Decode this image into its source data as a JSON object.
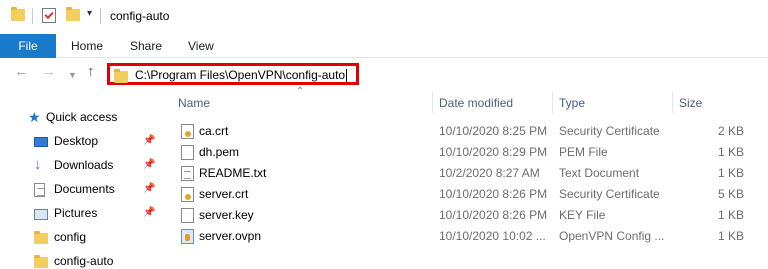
{
  "window": {
    "title": "config-auto"
  },
  "ribbon": {
    "tabs": [
      "File",
      "Home",
      "Share",
      "View"
    ]
  },
  "navigation": {
    "address": "C:\\Program Files\\OpenVPN\\config-auto"
  },
  "columns": {
    "name": "Name",
    "date": "Date modified",
    "type": "Type",
    "size": "Size"
  },
  "sidebar": {
    "items": [
      {
        "label": "Quick access",
        "icon": "star-icon",
        "pinned": false
      },
      {
        "label": "Desktop",
        "icon": "desktop-icon",
        "pinned": true
      },
      {
        "label": "Downloads",
        "icon": "download-icon",
        "pinned": true
      },
      {
        "label": "Documents",
        "icon": "documents-icon",
        "pinned": true
      },
      {
        "label": "Pictures",
        "icon": "pictures-icon",
        "pinned": true
      },
      {
        "label": "config",
        "icon": "folder-icon",
        "pinned": false
      },
      {
        "label": "config-auto",
        "icon": "folder-icon",
        "pinned": false
      }
    ]
  },
  "files": [
    {
      "name": "ca.crt",
      "date": "10/10/2020 8:25 PM",
      "type": "Security Certificate",
      "size": "2 KB",
      "icon": "certificate-icon"
    },
    {
      "name": "dh.pem",
      "date": "10/10/2020 8:29 PM",
      "type": "PEM File",
      "size": "1 KB",
      "icon": "file-icon"
    },
    {
      "name": "README.txt",
      "date": "10/2/2020 8:27 AM",
      "type": "Text Document",
      "size": "1 KB",
      "icon": "text-file-icon"
    },
    {
      "name": "server.crt",
      "date": "10/10/2020 8:26 PM",
      "type": "Security Certificate",
      "size": "5 KB",
      "icon": "certificate-icon"
    },
    {
      "name": "server.key",
      "date": "10/10/2020 8:26 PM",
      "type": "KEY File",
      "size": "1 KB",
      "icon": "file-icon"
    },
    {
      "name": "server.ovpn",
      "date": "10/10/2020 10:02 ...",
      "type": "OpenVPN Config ...",
      "size": "1 KB",
      "icon": "openvpn-config-icon"
    }
  ],
  "colors": {
    "file_tab": "#1979ca",
    "highlight_border": "#e00000",
    "folder": "#f3cd5e",
    "header_text": "#4c607a"
  }
}
